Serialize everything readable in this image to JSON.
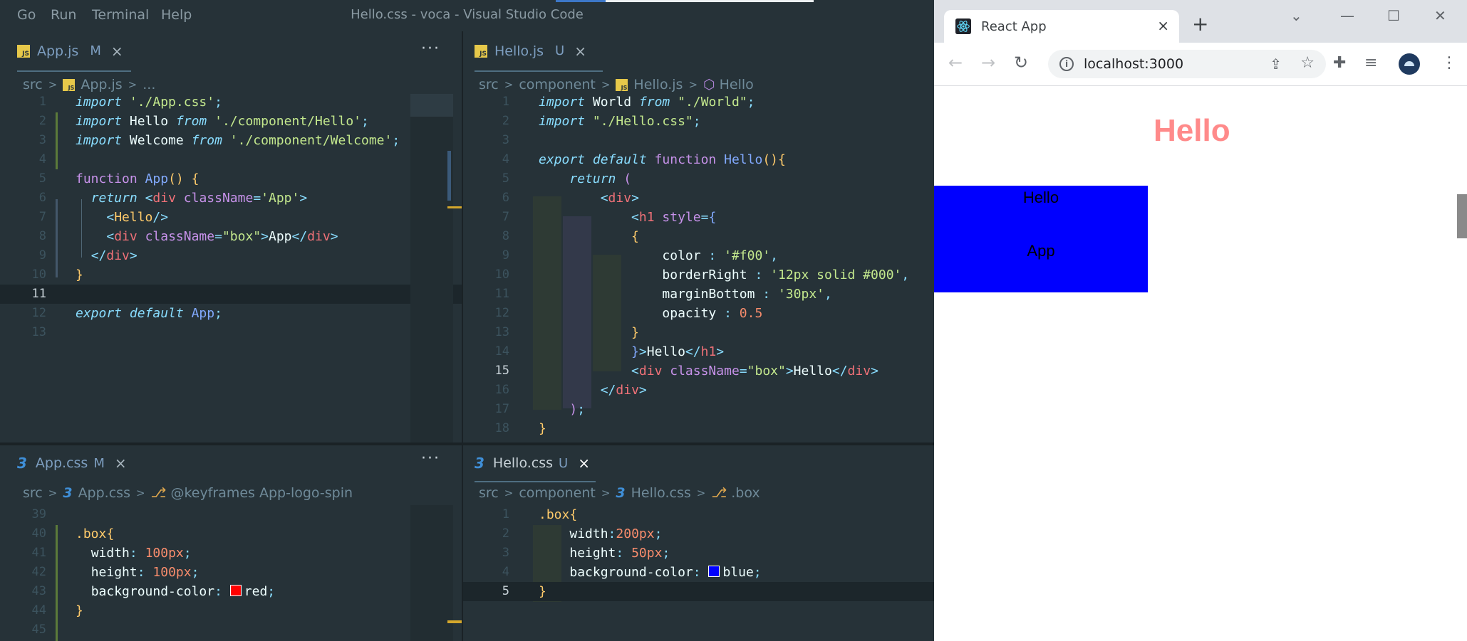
{
  "vscode": {
    "menu": [
      "Go",
      "Run",
      "Terminal",
      "Help"
    ],
    "window_title": "Hello.css - voca - Visual Studio Code",
    "top_left": {
      "tab": {
        "name": "App.js",
        "badge": "M",
        "close": "×",
        "icon_text": "JS"
      },
      "more": "···",
      "breadcrumb": {
        "folder": "src",
        "file": "App.js",
        "rest": "..."
      },
      "lines": [
        {
          "n": "1",
          "html": "<span class=\"k\">import</span> <span class=\"str\">'./App.css'</span><span class=\"punc\">;</span>"
        },
        {
          "n": "2",
          "html": "<span class=\"k\">import</span> <span class=\"pl\">Hello</span> <span class=\"k\">from</span> <span class=\"str\">'./component/Hello'</span><span class=\"punc\">;</span>"
        },
        {
          "n": "3",
          "html": "<span class=\"k\">import</span> <span class=\"pl\">Welcome</span> <span class=\"k\">from</span> <span class=\"str\">'./component/Welcome'</span><span class=\"punc\">;</span>"
        },
        {
          "n": "4",
          "html": ""
        },
        {
          "n": "5",
          "html": "<span class=\"kw\">function</span> <span class=\"fn\">App</span><span class=\"br\">()</span> <span class=\"br\">{</span>"
        },
        {
          "n": "6",
          "html": "  <span class=\"k\">return</span> <span class=\"punc\">&lt;</span><span class=\"tag\">div</span> <span class=\"attr\">className</span><span class=\"punc\">=</span><span class=\"str\">'App'</span><span class=\"punc\">&gt;</span>"
        },
        {
          "n": "7",
          "html": "    <span class=\"punc\">&lt;</span><span class=\"cls\">Hello</span><span class=\"punc\">/&gt;</span>"
        },
        {
          "n": "8",
          "html": "    <span class=\"punc\">&lt;</span><span class=\"tag\">div</span> <span class=\"attr\">className</span><span class=\"punc\">=</span><span class=\"str\">\"box\"</span><span class=\"punc\">&gt;</span><span class=\"pl\">App</span><span class=\"punc\">&lt;/</span><span class=\"tag\">div</span><span class=\"punc\">&gt;</span>"
        },
        {
          "n": "9",
          "html": "  <span class=\"punc\">&lt;/</span><span class=\"tag\">div</span><span class=\"punc\">&gt;</span>"
        },
        {
          "n": "10",
          "html": "<span class=\"br\">}</span>"
        },
        {
          "n": "11",
          "html": "",
          "current": true
        },
        {
          "n": "12",
          "html": "<span class=\"k\">export</span> <span class=\"k\">default</span> <span class=\"fn\">App</span><span class=\"punc\">;</span>"
        },
        {
          "n": "13",
          "html": ""
        }
      ]
    },
    "top_right": {
      "tab": {
        "name": "Hello.js",
        "badge": "U",
        "close": "×",
        "icon_text": "JS"
      },
      "breadcrumb": {
        "folder": "src",
        "sub": "component",
        "file": "Hello.js",
        "symbol": "Hello"
      },
      "lines": [
        {
          "n": "1",
          "html": "<span class=\"k\">import</span> <span class=\"pl\">World</span> <span class=\"k\">from</span> <span class=\"str\">\"./World\"</span><span class=\"punc\">;</span>"
        },
        {
          "n": "2",
          "html": "<span class=\"k\">import</span> <span class=\"str\">\"./Hello.css\"</span><span class=\"punc\">;</span>"
        },
        {
          "n": "3",
          "html": ""
        },
        {
          "n": "4",
          "html": "<span class=\"k\">export</span> <span class=\"k\">default</span> <span class=\"kw\">function</span> <span class=\"fn\">Hello</span><span class=\"br\">(){</span>"
        },
        {
          "n": "5",
          "html": "    <span class=\"k\">return</span> <span class=\"br2\">(</span>"
        },
        {
          "n": "6",
          "html": "        <span class=\"punc\">&lt;</span><span class=\"tag\">div</span><span class=\"punc\">&gt;</span>"
        },
        {
          "n": "7",
          "html": "            <span class=\"punc\">&lt;</span><span class=\"tag\">h1</span> <span class=\"attr\">style</span><span class=\"punc\">=</span><span class=\"br3\">{</span>"
        },
        {
          "n": "8",
          "html": "            <span class=\"br\">{</span>"
        },
        {
          "n": "9",
          "html": "                <span class=\"prop\">color</span> <span class=\"punc\">:</span> <span class=\"str\">'#f00'</span><span class=\"punc\">,</span>"
        },
        {
          "n": "10",
          "html": "                <span class=\"prop\">borderRight</span> <span class=\"punc\">:</span> <span class=\"str\">'12px solid #000'</span><span class=\"punc\">,</span>"
        },
        {
          "n": "11",
          "html": "                <span class=\"prop\">marginBottom</span> <span class=\"punc\">:</span> <span class=\"str\">'30px'</span><span class=\"punc\">,</span>"
        },
        {
          "n": "12",
          "html": "                <span class=\"prop\">opacity</span> <span class=\"punc\">:</span> <span class=\"num\">0.5</span>"
        },
        {
          "n": "13",
          "html": "            <span class=\"br\">}</span>"
        },
        {
          "n": "14",
          "html": "            <span class=\"br3\">}</span><span class=\"punc\">&gt;</span><span class=\"pl\">Hello</span><span class=\"punc\">&lt;/</span><span class=\"tag\">h1</span><span class=\"punc\">&gt;</span>"
        },
        {
          "n": "15",
          "html": "            <span class=\"punc\">&lt;</span><span class=\"tag\">div</span> <span class=\"attr\">className</span><span class=\"punc\">=</span><span class=\"str\">\"box\"</span><span class=\"punc\">&gt;</span><span class=\"pl\">Hello</span><span class=\"punc\">&lt;/</span><span class=\"tag\">div</span><span class=\"punc\">&gt;</span>",
          "current_num": true
        },
        {
          "n": "16",
          "html": "        <span class=\"punc\">&lt;/</span><span class=\"tag\">div</span><span class=\"punc\">&gt;</span>"
        },
        {
          "n": "17",
          "html": "    <span class=\"br2\">)</span><span class=\"punc\">;</span>"
        },
        {
          "n": "18",
          "html": "<span class=\"br\">}</span>"
        }
      ]
    },
    "bottom_left": {
      "tab": {
        "name": "App.css",
        "badge": "M",
        "close": "×",
        "icon_text": "3"
      },
      "more": "···",
      "breadcrumb": {
        "folder": "src",
        "file": "App.css",
        "symbol": "@keyframes App-logo-spin"
      },
      "lines": [
        {
          "n": "39",
          "html": ""
        },
        {
          "n": "40",
          "html": "<span class=\"cls\">.box</span><span class=\"br\">{</span>"
        },
        {
          "n": "41",
          "html": "  <span class=\"prop\">width</span><span class=\"punc\">:</span> <span class=\"num\">100px</span><span class=\"punc\">;</span>"
        },
        {
          "n": "42",
          "html": "  <span class=\"prop\">height</span><span class=\"punc\">:</span> <span class=\"num\">100px</span><span class=\"punc\">;</span>"
        },
        {
          "n": "43",
          "html": "  <span class=\"prop\">background-color</span><span class=\"punc\">:</span> <span class=\"swatch\" style=\"background:#ff0000\"></span><span class=\"pl\">red</span><span class=\"punc\">;</span>"
        },
        {
          "n": "44",
          "html": "<span class=\"br\">}</span>"
        },
        {
          "n": "45",
          "html": ""
        }
      ]
    },
    "bottom_right": {
      "tab": {
        "name": "Hello.css",
        "badge": "U",
        "close": "×",
        "icon_text": "3"
      },
      "breadcrumb": {
        "folder": "src",
        "sub": "component",
        "file": "Hello.css",
        "symbol": ".box"
      },
      "lines": [
        {
          "n": "1",
          "html": "<span class=\"cls\">.box</span><span class=\"br\">{</span>"
        },
        {
          "n": "2",
          "html": "    <span class=\"prop\">width</span><span class=\"punc\">:</span><span class=\"num\">200px</span><span class=\"punc\">;</span>"
        },
        {
          "n": "3",
          "html": "    <span class=\"prop\">height</span><span class=\"punc\">:</span> <span class=\"num\">50px</span><span class=\"punc\">;</span>"
        },
        {
          "n": "4",
          "html": "    <span class=\"prop\">background-color</span><span class=\"punc\">:</span> <span class=\"swatch\" style=\"background:#0000ff\"></span><span class=\"pl\">blue</span><span class=\"punc\">;</span>"
        },
        {
          "n": "5",
          "html": "<span class=\"br\">}</span>",
          "current": true
        }
      ]
    }
  },
  "chrome": {
    "tab_title": "React App",
    "tab_close": "×",
    "new_tab": "+",
    "url": "localhost:3000",
    "page": {
      "heading": "Hello",
      "box_text_1": "Hello",
      "box_text_2": "App"
    },
    "colors": {
      "heading": "#ff8a8a",
      "box": "#0000ff"
    }
  }
}
